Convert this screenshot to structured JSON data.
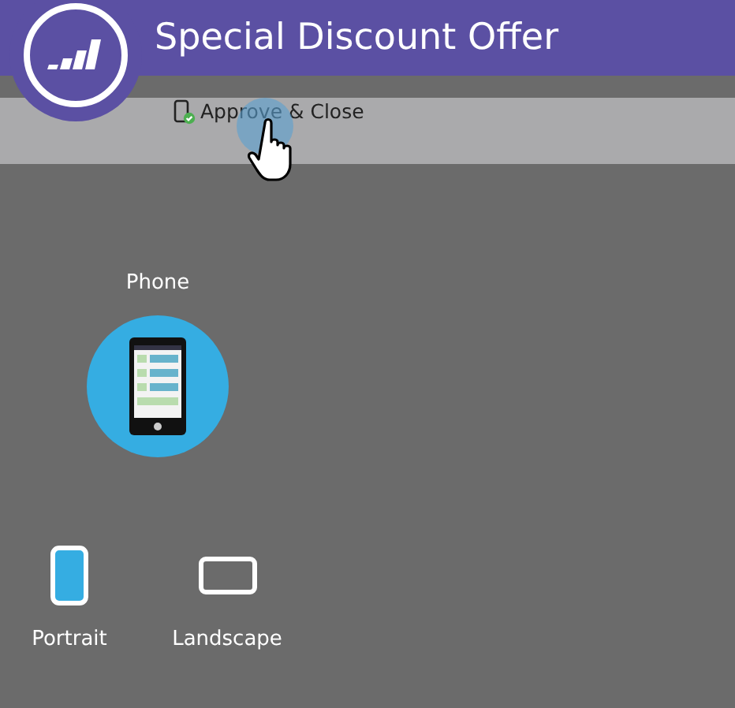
{
  "header": {
    "title": "Special Discount Offer"
  },
  "toolbar": {
    "buttons": [
      {
        "label": "Approve & Close"
      }
    ]
  },
  "device": {
    "label": "Phone",
    "selected": true
  },
  "orientations": [
    {
      "label": "Portrait",
      "kind": "portrait",
      "selected": true
    },
    {
      "label": "Landscape",
      "kind": "landscape",
      "selected": false
    }
  ]
}
